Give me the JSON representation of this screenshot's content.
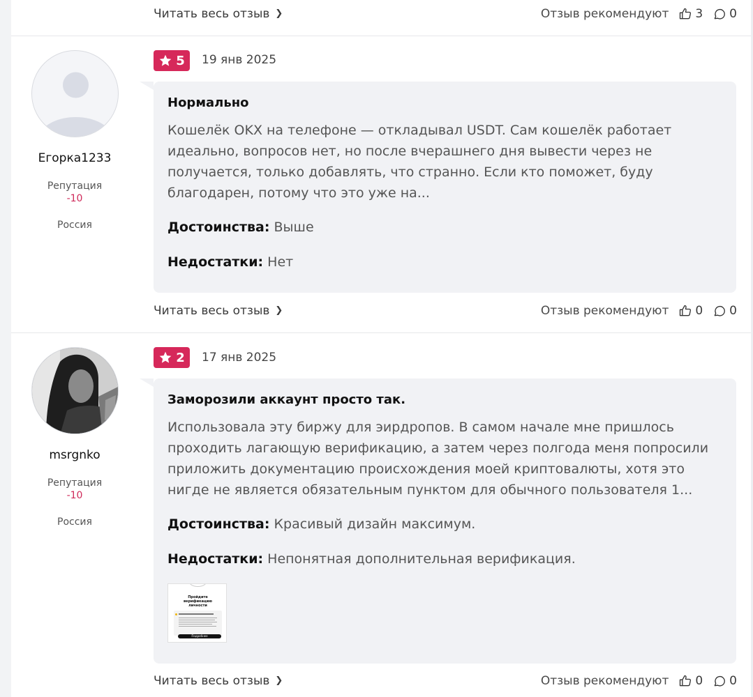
{
  "common": {
    "read_more": "Читать весь отзыв",
    "recommend_label": "Отзыв рекомендуют",
    "reputation_label": "Репутация",
    "pros_label": "Достоинства:",
    "cons_label": "Недостатки:"
  },
  "top_footer": {
    "likes": "3",
    "comments": "0"
  },
  "reviews": [
    {
      "username": "Егорка1233",
      "reputation": "-10",
      "country": "Россия",
      "rating": "5",
      "date": "19 янв 2025",
      "title": "Нормально",
      "text": "Кошелёк OKX на телефоне — откладывал USDT. Сам кошелёк работает идеально, вопросов нет, но после вчерашнего дня вывести через не получается, только добавлять, что странно. Если кто поможет, буду благодарен, потому что это уже на...",
      "pros": "Выше",
      "cons": "Нет",
      "likes": "0",
      "comments": "0"
    },
    {
      "username": "msrgnko",
      "reputation": "-10",
      "country": "Россия",
      "rating": "2",
      "date": "17 янв 2025",
      "title": "Заморозили аккаунт просто так.",
      "text": "Использовала эту биржу для эирдропов. В самом начале мне пришлось проходить лагающую верификацию, а затем через полгода меня попросили приложить документацию происхождения моей криптовалюты, хотя это нигде не является обязательным пунктом для обычного пользователя 1...",
      "pros": "Красивый дизайн максимум.",
      "cons": "Непонятная дополнительная верификация.",
      "likes": "0",
      "comments": "0",
      "attachment": {
        "heading": "Пройдите верификацию личности",
        "button": "Подробнее"
      }
    }
  ],
  "colors": {
    "accent": "#d6285a",
    "reputation": "#cf2a5a",
    "bubble": "#f1f2f5"
  }
}
